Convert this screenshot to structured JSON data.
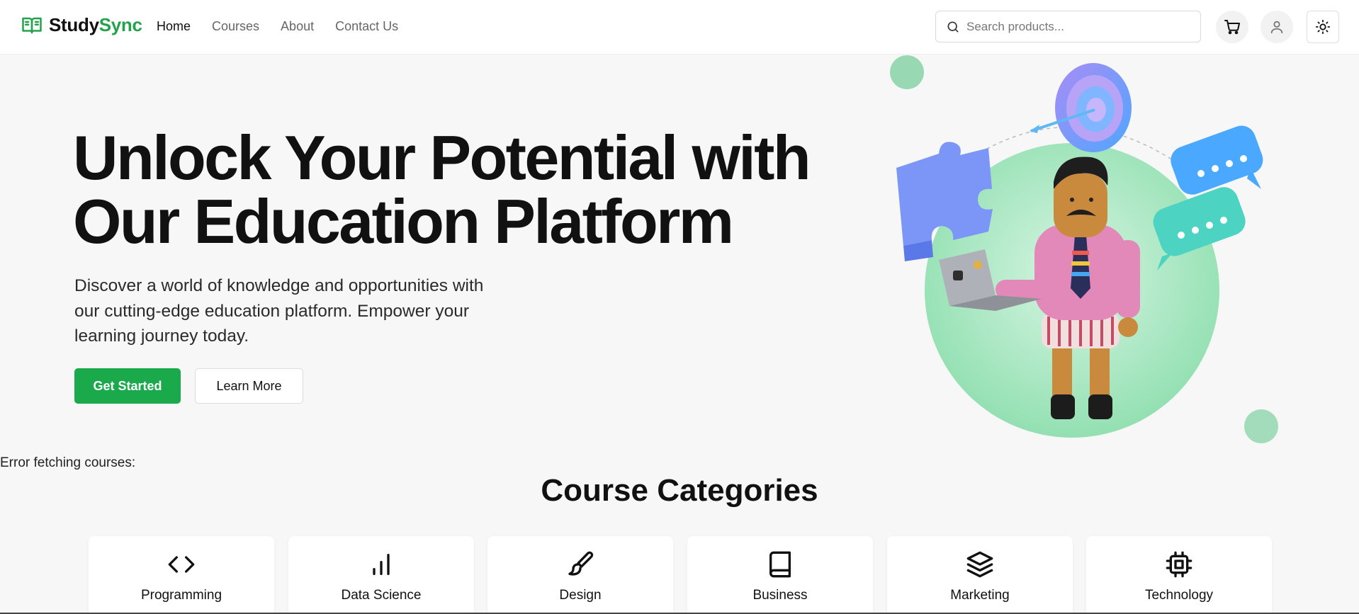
{
  "brand": {
    "name_part1": "Study",
    "name_part2": "Sync",
    "accent": "#22a24a"
  },
  "nav": {
    "links": [
      "Home",
      "Courses",
      "About",
      "Contact Us"
    ],
    "active": "Home"
  },
  "search": {
    "placeholder": "Search products..."
  },
  "header_icons": [
    "cart-icon",
    "user-icon",
    "sun-icon"
  ],
  "hero": {
    "title": "Unlock Your Potential with Our Education Platform",
    "subtitle": "Discover a world of knowledge and opportunities with our cutting-edge education platform. Empower your learning journey today.",
    "primary_button": "Get Started",
    "secondary_button": "Learn More",
    "primary_color": "#1aa94b"
  },
  "error_message": "Error fetching courses:",
  "categories": {
    "title": "Course Categories",
    "items": [
      {
        "label": "Programming",
        "icon": "code-icon"
      },
      {
        "label": "Data Science",
        "icon": "bar-chart-icon"
      },
      {
        "label": "Design",
        "icon": "paintbrush-icon"
      },
      {
        "label": "Business",
        "icon": "book-icon"
      },
      {
        "label": "Marketing",
        "icon": "layers-icon"
      },
      {
        "label": "Technology",
        "icon": "cpu-icon"
      }
    ]
  }
}
